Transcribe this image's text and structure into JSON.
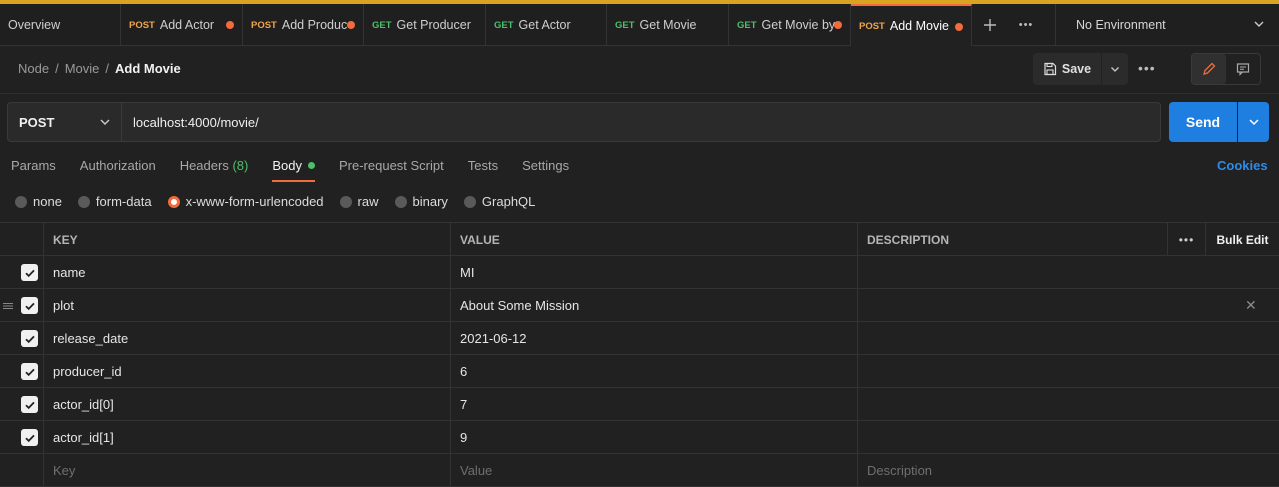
{
  "colors": {
    "accent": "#f26b3a",
    "brand_bar": "#d9a41f",
    "send": "#1f7fe0",
    "get": "#4fbf6b",
    "post": "#f0a54a"
  },
  "tabs": [
    {
      "method": "",
      "label": "Overview",
      "dot": false,
      "active": false
    },
    {
      "method": "POST",
      "label": "Add Actor",
      "dot": true,
      "active": false
    },
    {
      "method": "POST",
      "label": "Add Produc",
      "dot": true,
      "active": false
    },
    {
      "method": "GET",
      "label": "Get Producer",
      "dot": false,
      "active": false
    },
    {
      "method": "GET",
      "label": "Get Actor",
      "dot": false,
      "active": false
    },
    {
      "method": "GET",
      "label": "Get Movie",
      "dot": false,
      "active": false
    },
    {
      "method": "GET",
      "label": "Get Movie by",
      "dot": true,
      "active": false
    },
    {
      "method": "POST",
      "label": "Add Movie",
      "dot": true,
      "active": true
    }
  ],
  "tab_controls": {
    "add_icon": "plus-icon",
    "more_icon": "more-horizontal-icon"
  },
  "environment": {
    "label": "No Environment"
  },
  "breadcrumb": {
    "items": [
      "Node",
      "Movie"
    ],
    "current": "Add Movie",
    "separator": "/"
  },
  "toolbar": {
    "save_label": "Save",
    "more_label": "•••"
  },
  "request": {
    "method": "POST",
    "url": "localhost:4000/movie/",
    "send_label": "Send"
  },
  "request_tabs": [
    {
      "label": "Params"
    },
    {
      "label": "Authorization"
    },
    {
      "label": "Headers",
      "count": "(8)"
    },
    {
      "label": "Body",
      "active": true,
      "indicator": true
    },
    {
      "label": "Pre-request Script"
    },
    {
      "label": "Tests"
    },
    {
      "label": "Settings"
    }
  ],
  "cookies_label": "Cookies",
  "body_types": [
    {
      "label": "none",
      "selected": false
    },
    {
      "label": "form-data",
      "selected": false
    },
    {
      "label": "x-www-form-urlencoded",
      "selected": true
    },
    {
      "label": "raw",
      "selected": false
    },
    {
      "label": "binary",
      "selected": false
    },
    {
      "label": "GraphQL",
      "selected": false
    }
  ],
  "table": {
    "headers": {
      "key": "KEY",
      "value": "VALUE",
      "description": "DESCRIPTION",
      "more": "•••",
      "bulk_edit": "Bulk Edit"
    },
    "rows": [
      {
        "key": "name",
        "value": "MI",
        "description": "",
        "checked": true
      },
      {
        "key": "plot",
        "value": "About Some Mission",
        "description": "",
        "checked": true,
        "hovered": true
      },
      {
        "key": "release_date",
        "value": "2021-06-12",
        "description": "",
        "checked": true
      },
      {
        "key": "producer_id",
        "value": "6",
        "description": "",
        "checked": true
      },
      {
        "key": "actor_id[0]",
        "value": "7",
        "description": "",
        "checked": true
      },
      {
        "key": "actor_id[1]",
        "value": "9",
        "description": "",
        "checked": true
      }
    ],
    "placeholders": {
      "key": "Key",
      "value": "Value",
      "description": "Description"
    }
  }
}
